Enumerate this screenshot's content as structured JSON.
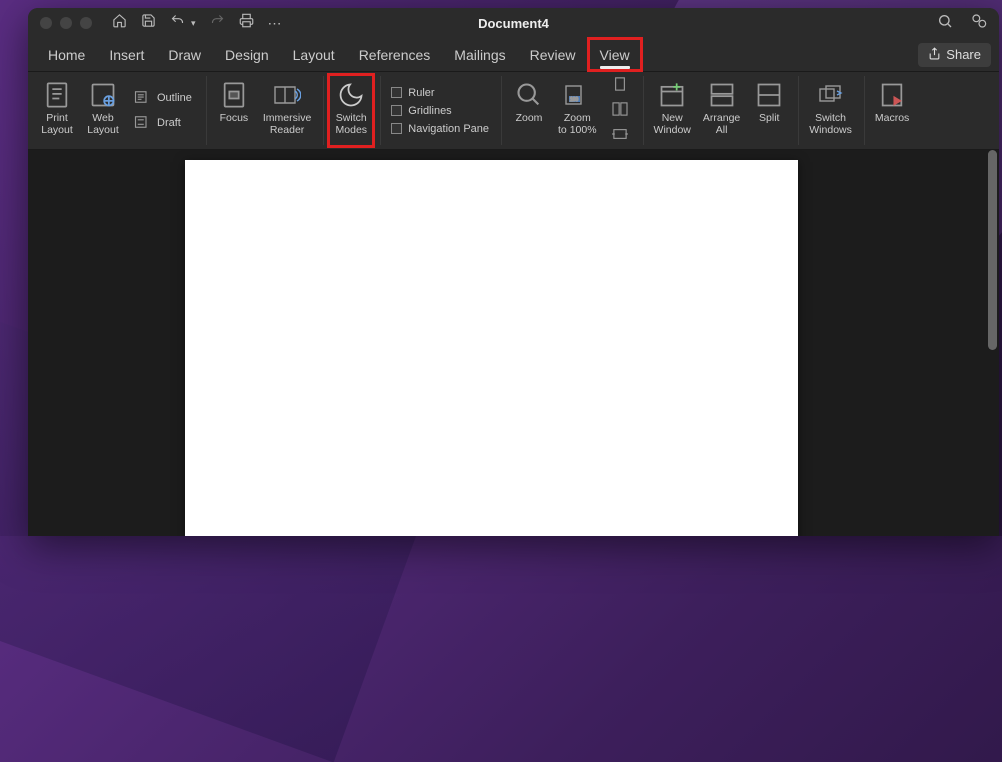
{
  "title": "Document4",
  "tabs": [
    {
      "label": "Home"
    },
    {
      "label": "Insert"
    },
    {
      "label": "Draw"
    },
    {
      "label": "Design"
    },
    {
      "label": "Layout"
    },
    {
      "label": "References"
    },
    {
      "label": "Mailings"
    },
    {
      "label": "Review"
    },
    {
      "label": "View"
    }
  ],
  "share_label": "Share",
  "ribbon": {
    "print_layout": "Print\nLayout",
    "web_layout": "Web\nLayout",
    "outline": "Outline",
    "draft": "Draft",
    "focus": "Focus",
    "immersive_reader": "Immersive\nReader",
    "switch_modes": "Switch\nModes",
    "ruler": "Ruler",
    "gridlines": "Gridlines",
    "navigation_pane": "Navigation Pane",
    "zoom": "Zoom",
    "zoom_100": "Zoom\nto 100%",
    "new_window": "New\nWindow",
    "arrange_all": "Arrange\nAll",
    "split": "Split",
    "switch_windows": "Switch\nWindows",
    "macros": "Macros"
  }
}
